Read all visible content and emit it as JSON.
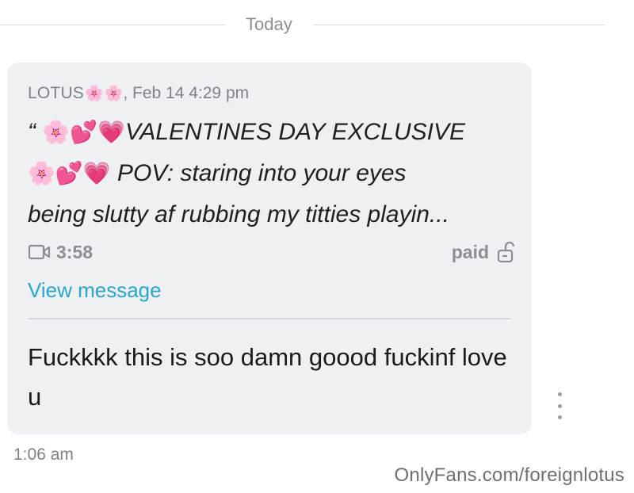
{
  "divider": {
    "label": "Today"
  },
  "quoted_message": {
    "sender": "LOTUS",
    "sender_emoji": "🌸",
    "date": ", Feb 14 4:29 pm",
    "preview_line1_emoji": "🌸💕💗",
    "preview_line1_text": "VALENTINES DAY EXCLUSIVE",
    "preview_line2_emoji": "🌸💕💗",
    "preview_line2_text": " POV: staring into your eyes",
    "preview_line3_text": "being slutty af rubbing my titties playin...",
    "quote_mark": "“",
    "video_duration": "3:58",
    "price_status": "paid",
    "view_link": "View message"
  },
  "reply": {
    "text": "Fuckkkk this is soo damn goood fuckinf love u"
  },
  "message_time": "1:06 am",
  "watermark": "OnlyFans.com/foreignlotus",
  "colors": {
    "bubble": "#eef0f3",
    "link": "#2aa7c8",
    "muted": "#7d8288"
  },
  "icons": [
    "video-camera-icon",
    "unlock-icon",
    "more-vertical-icon"
  ]
}
